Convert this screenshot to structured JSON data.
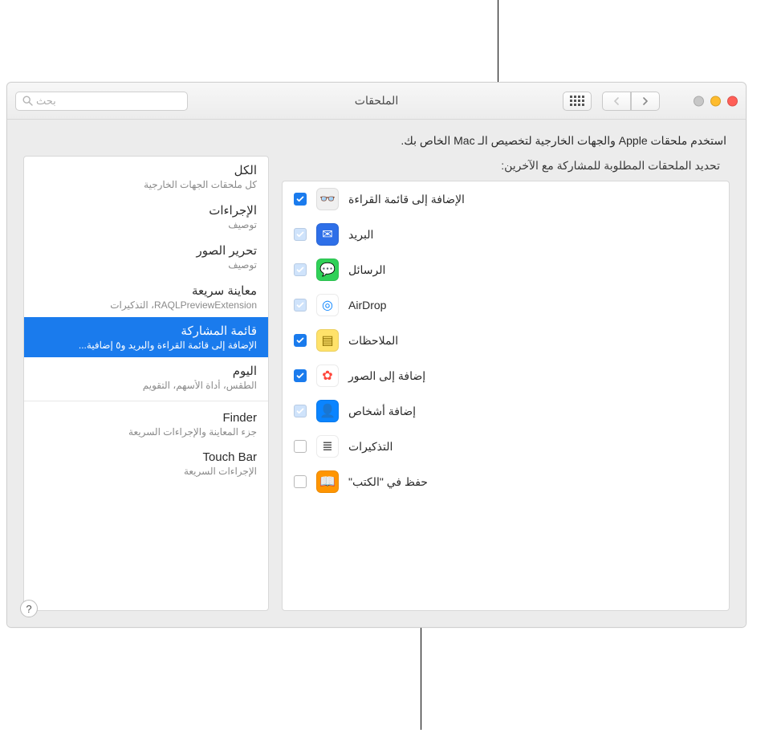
{
  "window": {
    "title": "الملحقات",
    "search_placeholder": "بحث"
  },
  "intro": "استخدم ملحقات Apple والجهات الخارجية لتخصيص الـ Mac الخاص بك.",
  "sidebar": {
    "items": [
      {
        "title": "الكل",
        "subtitle": "كل ملحقات الجهات الخارجية"
      },
      {
        "title": "الإجراءات",
        "subtitle": "توصيف"
      },
      {
        "title": "تحرير الصور",
        "subtitle": "توصيف"
      },
      {
        "title": "معاينة سريعة",
        "subtitle": "RAQLPreviewExtension، التذكيرات"
      },
      {
        "title": "قائمة المشاركة",
        "subtitle": "الإضافة إلى قائمة القراءة والبريد و٥ إضافية..."
      },
      {
        "title": "اليوم",
        "subtitle": "الطقس، أداة الأسهم، التقويم"
      },
      {
        "title": "Finder",
        "subtitle": "جزء المعاينة والإجراءات السريعة"
      },
      {
        "title": "Touch Bar",
        "subtitle": "الإجراءات السريعة"
      }
    ],
    "selected_index": 4
  },
  "detail": {
    "heading": "تحديد الملحقات المطلوبة للمشاركة مع الآخرين:",
    "rows": [
      {
        "label": "الإضافة إلى قائمة القراءة",
        "checked": true,
        "locked": false,
        "icon": "glasses",
        "bg": "#f0f0f0",
        "fg": "#7a7a7a"
      },
      {
        "label": "البريد",
        "checked": true,
        "locked": true,
        "icon": "mail",
        "bg": "#2e6fe8",
        "fg": "#fff"
      },
      {
        "label": "الرسائل",
        "checked": true,
        "locked": true,
        "icon": "messages",
        "bg": "#30d158",
        "fg": "#fff"
      },
      {
        "label": "AirDrop",
        "checked": true,
        "locked": true,
        "icon": "airdrop",
        "bg": "#ffffff",
        "fg": "#0a84ff"
      },
      {
        "label": "الملاحظات",
        "checked": true,
        "locked": false,
        "icon": "notes",
        "bg": "#ffe26a",
        "fg": "#8a6d00"
      },
      {
        "label": "إضافة إلى الصور",
        "checked": true,
        "locked": false,
        "icon": "photos",
        "bg": "#ffffff",
        "fg": "#ff453a"
      },
      {
        "label": "إضافة أشخاص",
        "checked": true,
        "locked": true,
        "icon": "people",
        "bg": "#0a84ff",
        "fg": "#fff"
      },
      {
        "label": "التذكيرات",
        "checked": false,
        "locked": false,
        "icon": "reminders",
        "bg": "#ffffff",
        "fg": "#555"
      },
      {
        "label": "حفظ في \"الكتب\"",
        "checked": false,
        "locked": false,
        "icon": "books",
        "bg": "#ff9500",
        "fg": "#fff"
      }
    ]
  },
  "icons": {
    "glasses": "👓",
    "mail": "✉︎",
    "messages": "💬",
    "airdrop": "◎",
    "notes": "▤",
    "photos": "✿",
    "people": "👤",
    "reminders": "≣",
    "books": "📖"
  }
}
